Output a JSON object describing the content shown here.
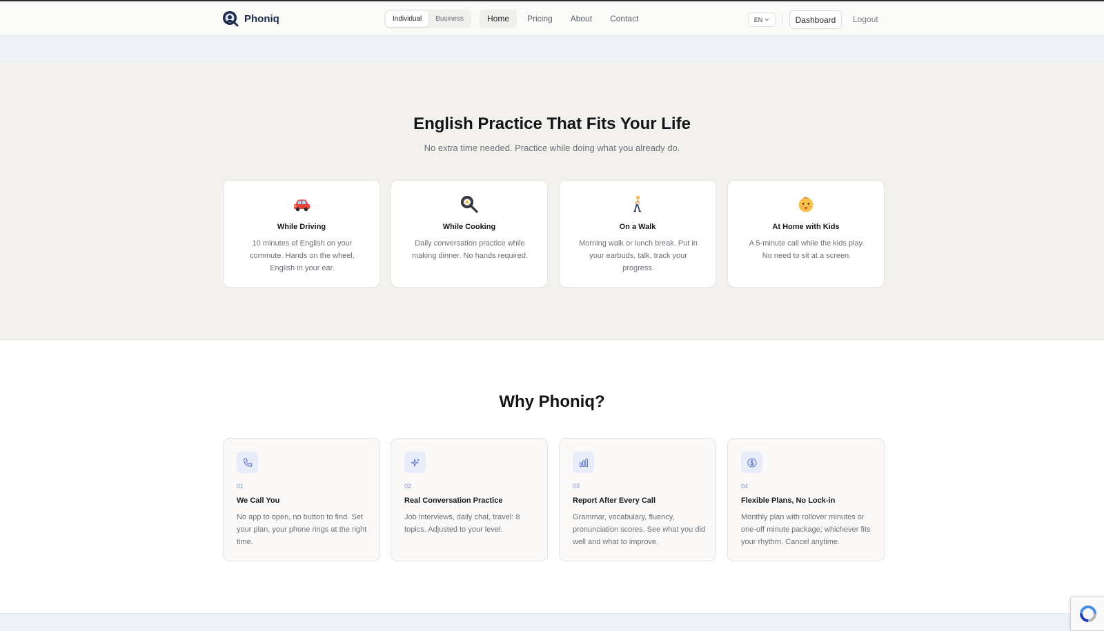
{
  "brand": {
    "name": "Phoniq",
    "logo_icon": "phoniq-logo-icon"
  },
  "nav": {
    "segments": [
      {
        "label": "Individual",
        "active": true
      },
      {
        "label": "Business",
        "active": false
      }
    ],
    "links": [
      {
        "label": "Home",
        "active": true
      },
      {
        "label": "Pricing",
        "active": false
      },
      {
        "label": "About",
        "active": false
      },
      {
        "label": "Contact",
        "active": false
      }
    ],
    "language": "EN",
    "dashboard_label": "Dashboard",
    "logout_label": "Logout"
  },
  "fits_section": {
    "title": "English Practice That Fits Your Life",
    "subtitle": "No extra time needed. Practice while doing what you already do.",
    "cards": [
      {
        "icon": "car-icon",
        "title": "While Driving",
        "desc": "10 minutes of English on your commute. Hands on the wheel, English in your ear."
      },
      {
        "icon": "cooking-pan-icon",
        "title": "While Cooking",
        "desc": "Daily conversation practice while making dinner. No hands required."
      },
      {
        "icon": "walking-person-icon",
        "title": "On a Walk",
        "desc": "Morning walk or lunch break. Put in your earbuds, talk, track your progress."
      },
      {
        "icon": "baby-face-icon",
        "title": "At Home with Kids",
        "desc": "A 5-minute call while the kids play. No need to sit at a screen."
      }
    ]
  },
  "why_section": {
    "title": "Why Phoniq?",
    "cards": [
      {
        "icon": "phone-icon",
        "number": "01",
        "title": "We Call You",
        "desc": "No app to open, no button to find. Set your plan, your phone rings at the right time."
      },
      {
        "icon": "sparkles-icon",
        "number": "02",
        "title": "Real Conversation Practice",
        "desc": "Job interviews, daily chat, travel: 8 topics. Adjusted to your level."
      },
      {
        "icon": "bar-chart-icon",
        "number": "03",
        "title": "Report After Every Call",
        "desc": "Grammar, vocabulary, fluency, pronunciation scores. See what you did well and what to improve."
      },
      {
        "icon": "dollar-circle-icon",
        "number": "04",
        "title": "Flexible Plans, No Lock-in",
        "desc": "Monthly plan with rollover minutes or one-off minute package; whichever fits your rhythm. Cancel anytime."
      }
    ]
  },
  "colors": {
    "accent": "#5b74c4",
    "icon_bg": "#e8ecf8",
    "section_bg": "#f2f1ee",
    "strip_bg": "#eef1f8"
  },
  "recaptcha_icon": "recaptcha-icon"
}
